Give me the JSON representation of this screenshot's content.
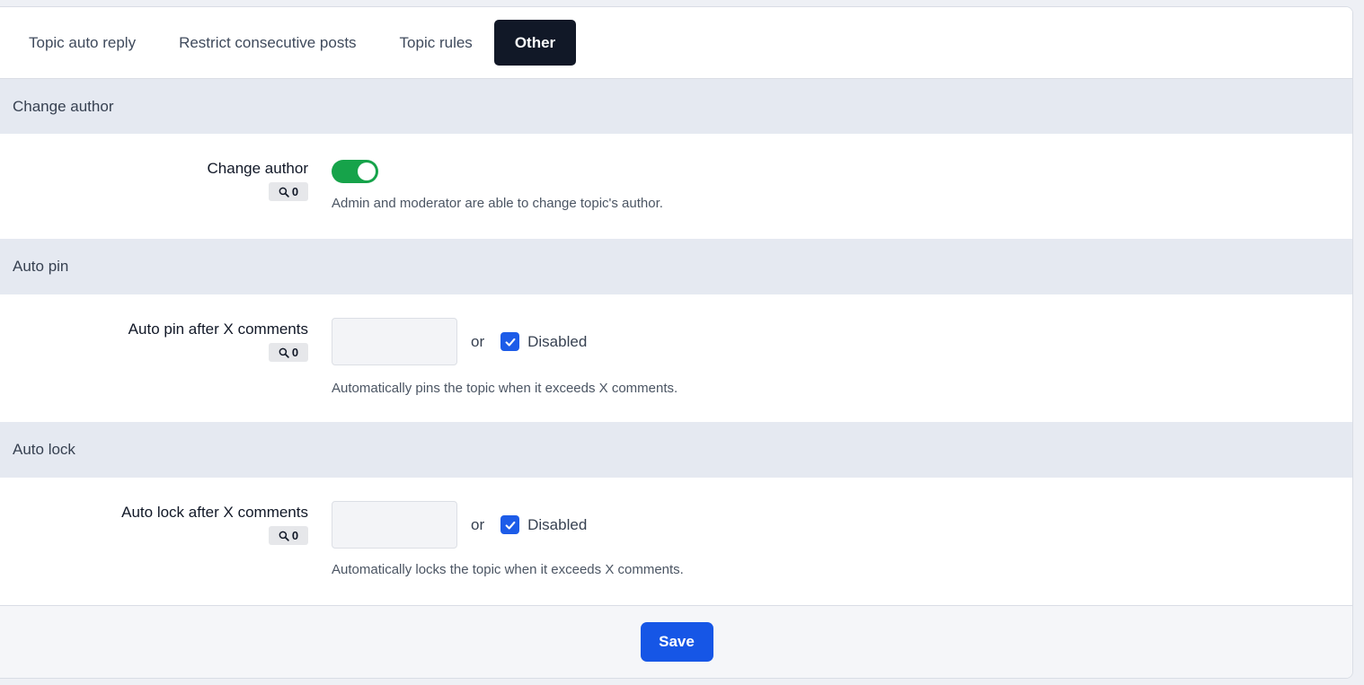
{
  "tabs": [
    {
      "label": "Topic auto reply",
      "active": false
    },
    {
      "label": "Restrict consecutive posts",
      "active": false
    },
    {
      "label": "Topic rules",
      "active": false
    },
    {
      "label": "Other",
      "active": true
    }
  ],
  "sections": {
    "change_author": {
      "header": "Change author",
      "field_label": "Change author",
      "badge_count": "0",
      "toggle_on": true,
      "help": "Admin and moderator are able to change topic's author."
    },
    "auto_pin": {
      "header": "Auto pin",
      "field_label": "Auto pin after X comments",
      "badge_count": "0",
      "input_value": "",
      "or_text": "or",
      "checkbox_label": "Disabled",
      "checked": true,
      "help": "Automatically pins the topic when it exceeds X comments."
    },
    "auto_lock": {
      "header": "Auto lock",
      "field_label": "Auto lock after X comments",
      "badge_count": "0",
      "input_value": "",
      "or_text": "or",
      "checkbox_label": "Disabled",
      "checked": true,
      "help": "Automatically locks the topic when it exceeds X comments."
    }
  },
  "footer": {
    "save_label": "Save"
  },
  "colors": {
    "active_tab": "#111827",
    "toggle_on": "#16a34a",
    "checkbox": "#1d5ce8",
    "save_button": "#1656e6",
    "section_header_bg": "#e5e9f1"
  }
}
